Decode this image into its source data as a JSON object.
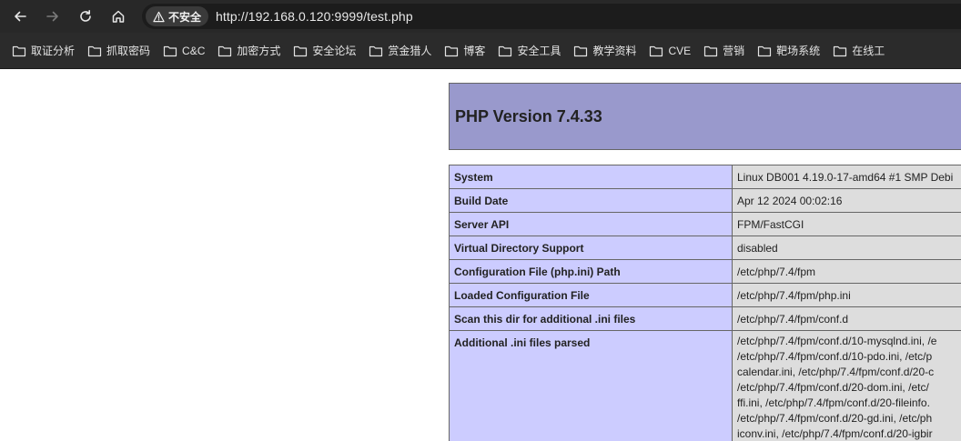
{
  "browser": {
    "security_label": "不安全",
    "url": "http://192.168.0.120:9999/test.php"
  },
  "bookmarks": [
    {
      "label": "取证分析"
    },
    {
      "label": "抓取密码"
    },
    {
      "label": "C&C"
    },
    {
      "label": "加密方式"
    },
    {
      "label": "安全论坛"
    },
    {
      "label": "赏金猎人"
    },
    {
      "label": "博客"
    },
    {
      "label": "安全工具"
    },
    {
      "label": "教学资料"
    },
    {
      "label": "CVE"
    },
    {
      "label": "营销"
    },
    {
      "label": "靶场系统"
    },
    {
      "label": "在线工"
    }
  ],
  "phpinfo": {
    "title": "PHP Version 7.4.33",
    "rows": [
      {
        "key": "System",
        "value": "Linux DB001 4.19.0-17-amd64 #1 SMP Debi"
      },
      {
        "key": "Build Date",
        "value": "Apr 12 2024 00:02:16"
      },
      {
        "key": "Server API",
        "value": "FPM/FastCGI"
      },
      {
        "key": "Virtual Directory Support",
        "value": "disabled"
      },
      {
        "key": "Configuration File (php.ini) Path",
        "value": "/etc/php/7.4/fpm"
      },
      {
        "key": "Loaded Configuration File",
        "value": "/etc/php/7.4/fpm/php.ini"
      },
      {
        "key": "Scan this dir for additional .ini files",
        "value": "/etc/php/7.4/fpm/conf.d"
      },
      {
        "key": "Additional .ini files parsed",
        "lines": [
          "/etc/php/7.4/fpm/conf.d/10-mysqlnd.ini, /e",
          "/etc/php/7.4/fpm/conf.d/10-pdo.ini, /etc/p",
          "calendar.ini, /etc/php/7.4/fpm/conf.d/20-c",
          "/etc/php/7.4/fpm/conf.d/20-dom.ini, /etc/",
          "ffi.ini, /etc/php/7.4/fpm/conf.d/20-fileinfo.",
          "/etc/php/7.4/fpm/conf.d/20-gd.ini, /etc/ph",
          "iconv.ini, /etc/php/7.4/fpm/conf.d/20-igbir"
        ]
      }
    ]
  }
}
